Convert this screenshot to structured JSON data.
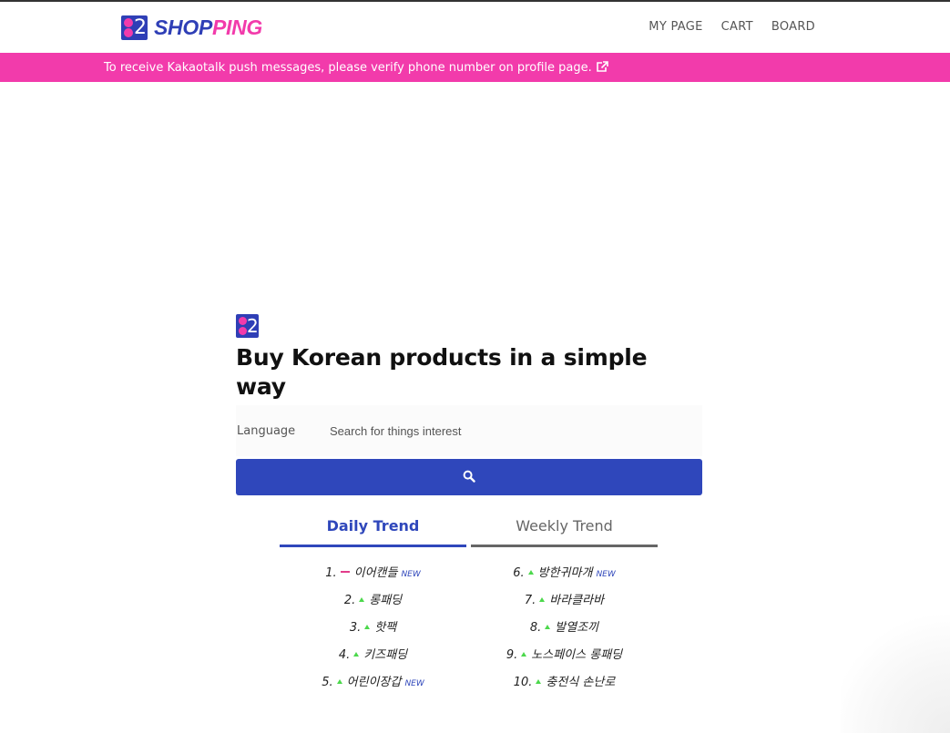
{
  "header": {
    "logo_two": "2",
    "logo_part1": "SHOP",
    "logo_part2": "PING",
    "nav": [
      "MY PAGE",
      "CART",
      "BOARD"
    ]
  },
  "banner": {
    "text": "To receive Kakaotalk push messages, please verify phone number on profile page."
  },
  "hero": {
    "mark_two": "2",
    "title": "Buy Korean products in a simple way",
    "language_label": "Language",
    "search_placeholder": "Search for things interest"
  },
  "trend": {
    "tabs": [
      "Daily Trend",
      "Weekly Trend"
    ],
    "active_tab": "Daily Trend",
    "left": [
      {
        "rank": "1.",
        "change": "same",
        "name": "이어캔들",
        "new": "NEW"
      },
      {
        "rank": "2.",
        "change": "up",
        "name": "롱패딩",
        "new": ""
      },
      {
        "rank": "3.",
        "change": "up",
        "name": "핫팩",
        "new": ""
      },
      {
        "rank": "4.",
        "change": "up",
        "name": "키즈패딩",
        "new": ""
      },
      {
        "rank": "5.",
        "change": "up",
        "name": "어린이장갑",
        "new": "NEW"
      }
    ],
    "right": [
      {
        "rank": "6.",
        "change": "up",
        "name": "방한귀마개",
        "new": "NEW"
      },
      {
        "rank": "7.",
        "change": "up",
        "name": "바라클라바",
        "new": ""
      },
      {
        "rank": "8.",
        "change": "up",
        "name": "발열조끼",
        "new": ""
      },
      {
        "rank": "9.",
        "change": "up",
        "name": "노스페이스 롱패딩",
        "new": ""
      },
      {
        "rank": "10.",
        "change": "up",
        "name": "충전식 손난로",
        "new": ""
      }
    ]
  },
  "colors": {
    "brand_blue": "#2f47bb",
    "brand_pink": "#f23bab",
    "up_arrow": "#4cd84c"
  }
}
